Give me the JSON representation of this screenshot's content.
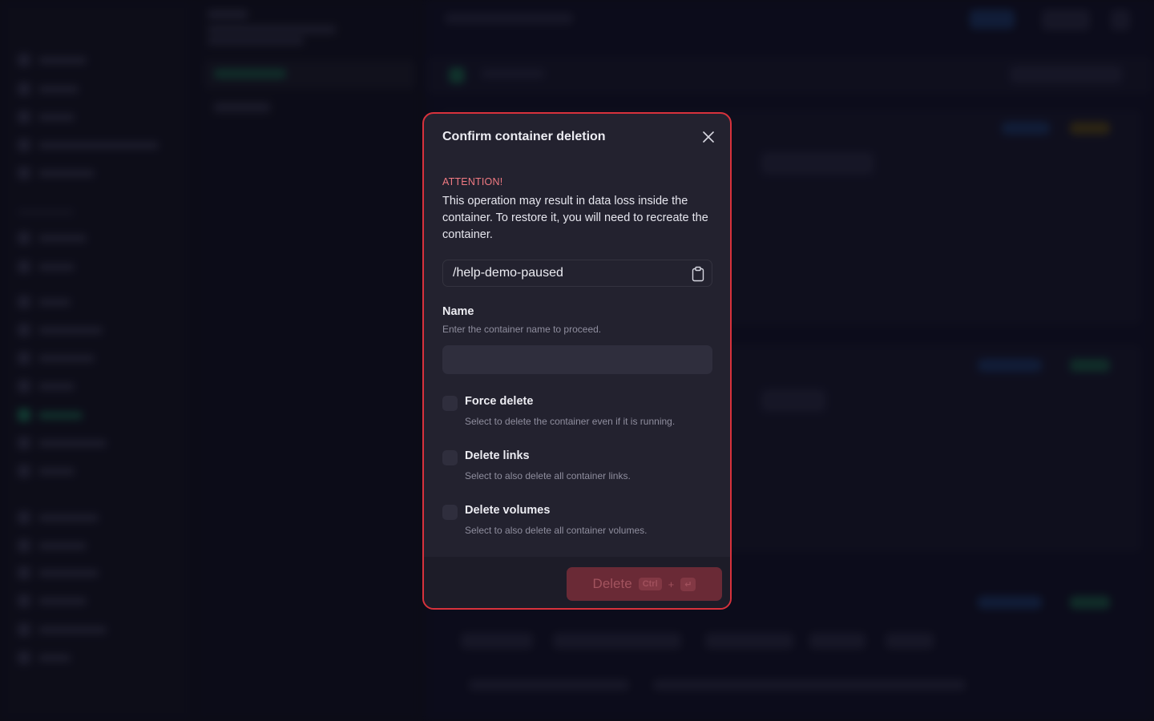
{
  "modal": {
    "title": "Confirm container deletion",
    "attention_label": "ATTENTION!",
    "attention_text": "This operation may result in data loss inside the container. To restore it, you will need to recreate the container.",
    "container_path": "/help-demo-paused",
    "name_label": "Name",
    "name_hint": "Enter the container name to proceed.",
    "name_value": "",
    "options": [
      {
        "label": "Force delete",
        "hint": "Select to delete the container even if it is running.",
        "checked": false
      },
      {
        "label": "Delete links",
        "hint": "Select to also delete all container links.",
        "checked": false
      },
      {
        "label": "Delete volumes",
        "hint": "Select to also delete all container volumes.",
        "checked": false
      }
    ],
    "delete_label": "Delete",
    "shortcut_ctrl": "Ctrl",
    "shortcut_plus": "+",
    "shortcut_enter": "↵"
  },
  "colors": {
    "danger_border": "#d8323c",
    "attention": "#f07a82",
    "modal_bg": "#23222f"
  }
}
